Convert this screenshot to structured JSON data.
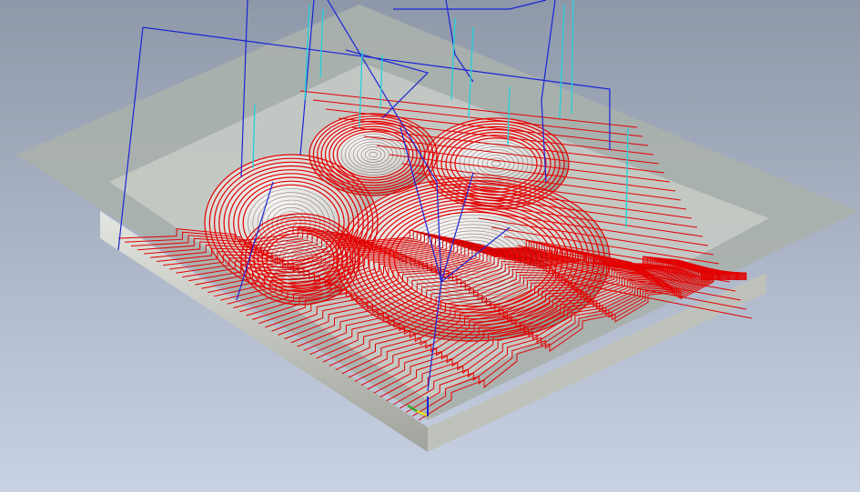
{
  "viewport": {
    "background_top": "#8e98a9",
    "background_bottom": "#c8d2e4"
  },
  "colors": {
    "stock_top": "#a9b1ac",
    "stock_side": "#c9ccc6",
    "pocket_floor": "#d8dbd6",
    "toolpath_cut": "#e30000",
    "toolpath_rapid": "#1a24d6",
    "toolpath_plunge": "#28d0d8",
    "origin_x_axis": "#f2e600",
    "origin_y_axis": "#22aa22"
  },
  "scene": {
    "description_icon": "cnc-3d-toolpath-view",
    "stock_icon": "stock-block-icon",
    "origin_icon": "origin-triad-icon"
  }
}
